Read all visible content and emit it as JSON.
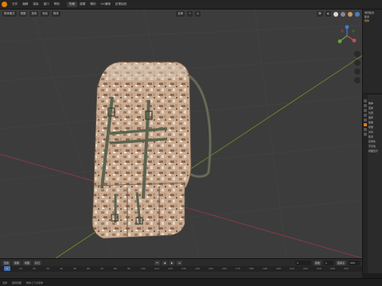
{
  "menubar": {
    "items": [
      "文件",
      "编辑",
      "渲染",
      "窗口",
      "帮助"
    ],
    "workspaces": [
      "布局",
      "建模",
      "雕刻",
      "UV编辑",
      "纹理绘制"
    ]
  },
  "viewport_header": {
    "mode": "物体模式",
    "view": "视图",
    "select": "选择",
    "add": "添加",
    "object": "物体",
    "transform": "全局"
  },
  "outliner": {
    "rows": [
      "场景集合",
      "集合",
      "物体"
    ]
  },
  "properties": {
    "rows": [
      "物体",
      "变换",
      "位置",
      "旋转",
      "缩放",
      "增量",
      "关系",
      "集合",
      "实例化",
      "可见性",
      "视图显示"
    ]
  },
  "timeline": {
    "controls": [
      "回放",
      "抠像",
      "视图",
      "标记"
    ],
    "current_frame": "1",
    "start_label": "起始",
    "start_value": "1",
    "end_label": "结束点",
    "end_value": "250",
    "ruler": [
      "0",
      "10",
      "20",
      "30",
      "40",
      "50",
      "60",
      "70",
      "80",
      "90",
      "100",
      "110",
      "120",
      "130",
      "140",
      "150",
      "160",
      "170",
      "180",
      "190",
      "200",
      "210",
      "220",
      "230",
      "240",
      "250"
    ]
  },
  "statusbar": {
    "items": [
      "选择",
      "旋转视图",
      "物体上下文菜单"
    ]
  },
  "colors": {
    "accent": "#e87d0d",
    "x_axis": "#8c3a46",
    "y_axis": "#6e8a2c",
    "viewport_bg": "#3c3c3c"
  },
  "icons": [
    "blender-logo-icon",
    "navigation-gizmo-icon",
    "zoom-icon",
    "hand-icon",
    "camera-icon",
    "grid-icon"
  ]
}
